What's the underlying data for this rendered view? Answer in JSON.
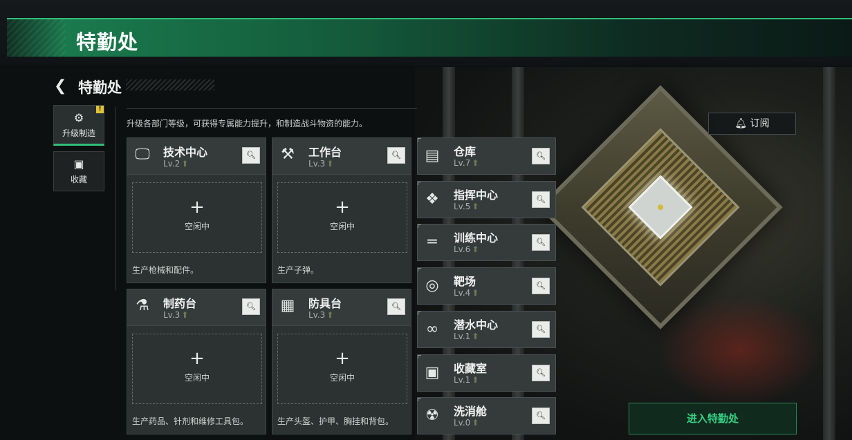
{
  "header": {
    "title": "特勤处"
  },
  "nav": {
    "back_icon": "back-arrow-icon",
    "title": "特勤处"
  },
  "sidebar": {
    "tabs": [
      {
        "label": "升级制造",
        "icon": "upgrade-gear-icon",
        "badge": "!"
      },
      {
        "label": "收藏",
        "icon": "collection-icon"
      }
    ]
  },
  "description": "升级各部门等级，可获得专属能力提升，和制造战斗物资的能力。",
  "subscribe": {
    "label": "订阅",
    "icon": "bell-icon"
  },
  "workshops": [
    {
      "name": "技术中心",
      "level": "Lv.2",
      "icon": "monitor-icon",
      "slot": {
        "plus": "+",
        "status": "空闲中"
      },
      "desc": "生产枪械和配件。"
    },
    {
      "name": "工作台",
      "level": "Lv.3",
      "icon": "tools-icon",
      "slot": {
        "plus": "+",
        "status": "空闲中"
      },
      "desc": "生产子弹。"
    },
    {
      "name": "制药台",
      "level": "Lv.3",
      "icon": "microscope-icon",
      "slot": {
        "plus": "+",
        "status": "空闲中"
      },
      "desc": "生产药品、针剂和维修工具包。"
    },
    {
      "name": "防具台",
      "level": "Lv.3",
      "icon": "armor-blocks-icon",
      "slot": {
        "plus": "+",
        "status": "空闲中"
      },
      "desc": "生产头盔、护甲、胸挂和背包。"
    }
  ],
  "facilities": [
    {
      "name": "仓库",
      "level": "Lv.7",
      "icon": "warehouse-icon"
    },
    {
      "name": "指挥中心",
      "level": "Lv.5",
      "icon": "command-icon"
    },
    {
      "name": "训练中心",
      "level": "Lv.6",
      "icon": "dumbbell-icon"
    },
    {
      "name": "靶场",
      "level": "Lv.4",
      "icon": "target-icon"
    },
    {
      "name": "潜水中心",
      "level": "Lv.1",
      "icon": "diving-goggles-icon"
    },
    {
      "name": "收藏室",
      "level": "Lv.1",
      "icon": "collection-room-icon"
    },
    {
      "name": "洗消舱",
      "level": "Lv.0",
      "icon": "decontamination-icon"
    }
  ],
  "enter_button": {
    "label": "进入特勤处"
  },
  "colors": {
    "accent": "#2fbf7a",
    "badge": "#e0c33a"
  }
}
